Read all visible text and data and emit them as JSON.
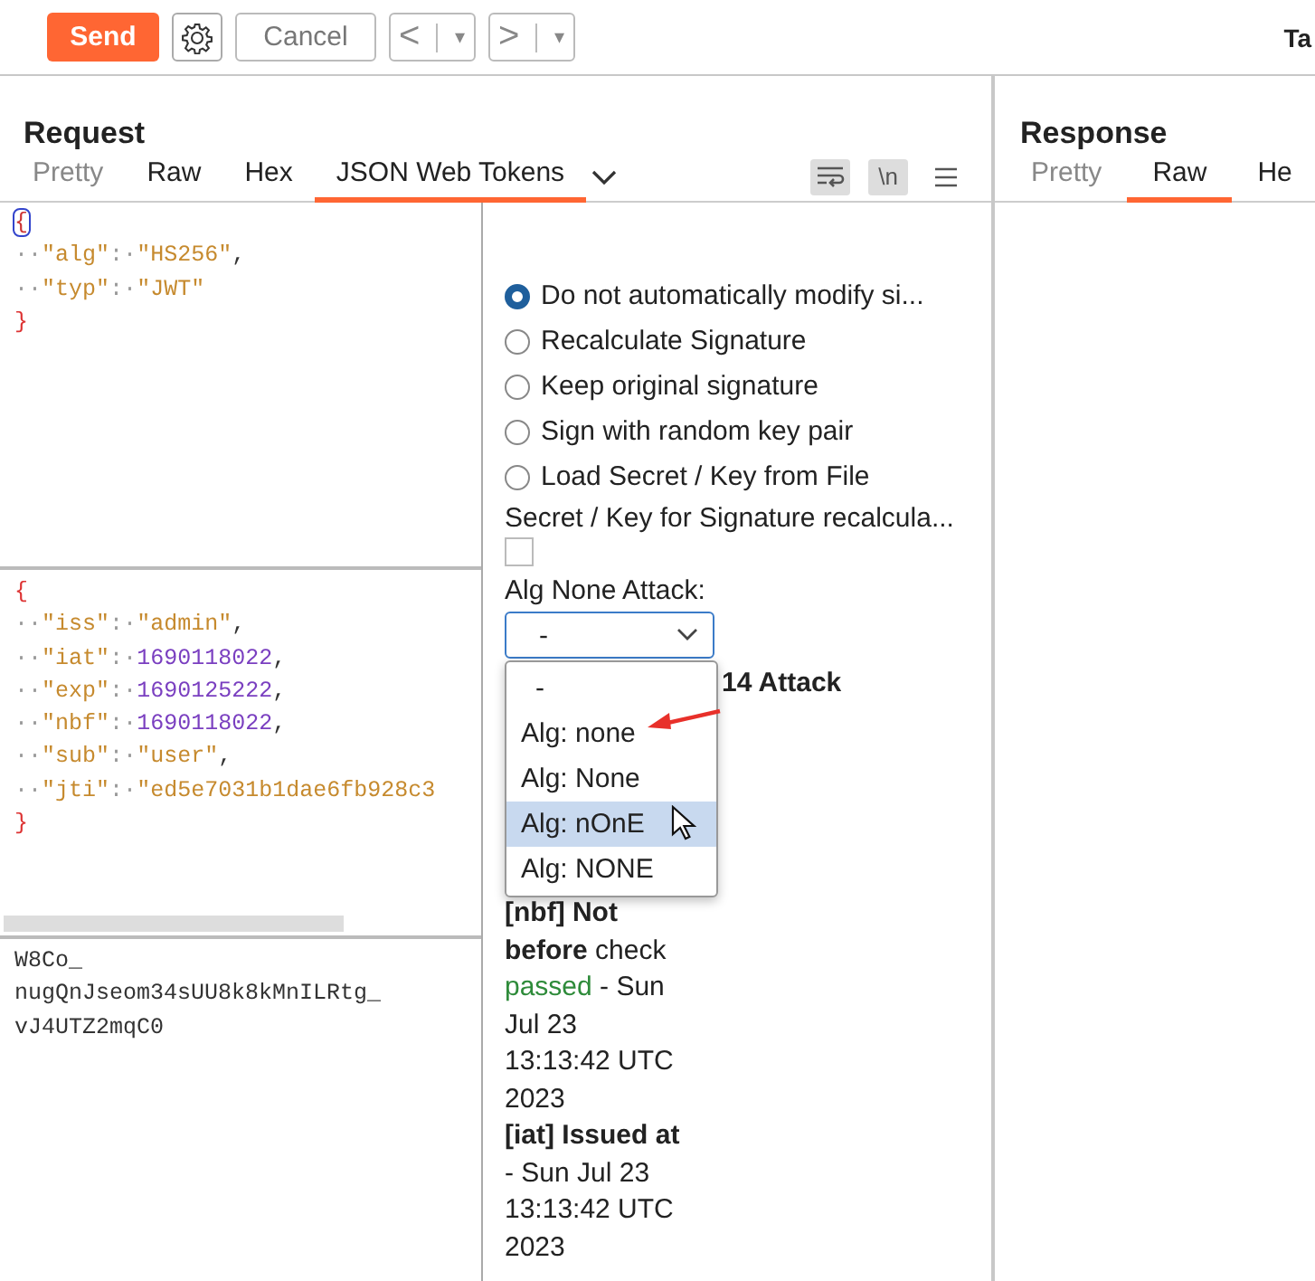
{
  "toolbar": {
    "send": "Send",
    "cancel": "Cancel",
    "back_arrow": "<",
    "back_caret": "▾",
    "forward_arrow": ">",
    "forward_caret": "▾",
    "cut_tab": "Ta"
  },
  "request": {
    "title": "Request",
    "tabs": [
      {
        "label": "Pretty",
        "selected": false,
        "muted": true
      },
      {
        "label": "Raw",
        "selected": false,
        "muted": false
      },
      {
        "label": "Hex",
        "selected": false,
        "muted": false
      },
      {
        "label": "JSON Web Tokens",
        "selected": true,
        "muted": false
      }
    ],
    "newline_toggle": "\\n",
    "header_lines": [
      [
        {
          "t": "{",
          "kind": "match"
        }
      ],
      [
        {
          "t": "··",
          "kind": "ws"
        },
        {
          "t": "\"alg\"",
          "kind": "str"
        },
        {
          "t": ":",
          "kind": "ws"
        },
        {
          "t": "·",
          "kind": "ws"
        },
        {
          "t": "\"HS256\"",
          "kind": "str"
        },
        {
          "t": ",",
          "kind": "punct"
        }
      ],
      [
        {
          "t": "··",
          "kind": "ws"
        },
        {
          "t": "\"typ\"",
          "kind": "str"
        },
        {
          "t": ":",
          "kind": "ws"
        },
        {
          "t": "·",
          "kind": "ws"
        },
        {
          "t": "\"JWT\"",
          "kind": "str"
        }
      ],
      [
        {
          "t": "}",
          "kind": "brace"
        }
      ]
    ],
    "payload_lines": [
      [
        {
          "t": "{",
          "kind": "brace"
        }
      ],
      [
        {
          "t": "··",
          "kind": "ws"
        },
        {
          "t": "\"iss\"",
          "kind": "str"
        },
        {
          "t": ":",
          "kind": "ws"
        },
        {
          "t": "·",
          "kind": "ws"
        },
        {
          "t": "\"admin\"",
          "kind": "str"
        },
        {
          "t": ",",
          "kind": "punct"
        }
      ],
      [
        {
          "t": "··",
          "kind": "ws"
        },
        {
          "t": "\"iat\"",
          "kind": "str"
        },
        {
          "t": ":",
          "kind": "ws"
        },
        {
          "t": "·",
          "kind": "ws"
        },
        {
          "t": "1690118022",
          "kind": "num"
        },
        {
          "t": ",",
          "kind": "punct"
        }
      ],
      [
        {
          "t": "··",
          "kind": "ws"
        },
        {
          "t": "\"exp\"",
          "kind": "str"
        },
        {
          "t": ":",
          "kind": "ws"
        },
        {
          "t": "·",
          "kind": "ws"
        },
        {
          "t": "1690125222",
          "kind": "num"
        },
        {
          "t": ",",
          "kind": "punct"
        }
      ],
      [
        {
          "t": "··",
          "kind": "ws"
        },
        {
          "t": "\"nbf\"",
          "kind": "str"
        },
        {
          "t": ":",
          "kind": "ws"
        },
        {
          "t": "·",
          "kind": "ws"
        },
        {
          "t": "1690118022",
          "kind": "num"
        },
        {
          "t": ",",
          "kind": "punct"
        }
      ],
      [
        {
          "t": "··",
          "kind": "ws"
        },
        {
          "t": "\"sub\"",
          "kind": "str"
        },
        {
          "t": ":",
          "kind": "ws"
        },
        {
          "t": "·",
          "kind": "ws"
        },
        {
          "t": "\"user\"",
          "kind": "str"
        },
        {
          "t": ",",
          "kind": "punct"
        }
      ],
      [
        {
          "t": "··",
          "kind": "ws"
        },
        {
          "t": "\"jti\"",
          "kind": "str"
        },
        {
          "t": ":",
          "kind": "ws"
        },
        {
          "t": "·",
          "kind": "ws"
        },
        {
          "t": "\"ed5e7031b1dae6fb928c3",
          "kind": "str"
        }
      ],
      [
        {
          "t": "}",
          "kind": "brace"
        }
      ]
    ],
    "signature_lines": [
      "W8Co_",
      "nugQnJseom34sUU8k8kMnILRtg_",
      "vJ4UTZ2mqC0"
    ]
  },
  "options": {
    "radios": [
      {
        "label": "Do not automatically modify si...",
        "selected": true
      },
      {
        "label": "Recalculate Signature",
        "selected": false
      },
      {
        "label": "Keep original signature",
        "selected": false
      },
      {
        "label": "Sign with random key pair",
        "selected": false
      },
      {
        "label": "Load Secret / Key from File",
        "selected": false
      }
    ],
    "secret_label": "Secret / Key for Signature recalcula...",
    "secret_checked": false,
    "alg_label": "Alg None Attack:",
    "alg_value": "-",
    "dropdown": [
      {
        "label": "-",
        "highlighted": false
      },
      {
        "label": "Alg: none",
        "highlighted": false
      },
      {
        "label": "Alg: None",
        "highlighted": false
      },
      {
        "label": "Alg: nOnE",
        "highlighted": true
      },
      {
        "label": "Alg: NONE",
        "highlighted": false
      }
    ],
    "behind_label": "14 Attack",
    "checks": [
      [
        {
          "t": "[nbf] Not before",
          "kind": "bold"
        },
        {
          "t": " check ",
          "kind": "plain"
        },
        {
          "t": "passed",
          "kind": "passed"
        },
        {
          "t": " - Sun Jul 23 13:13:42 UTC 2023",
          "kind": "plain"
        }
      ],
      [
        {
          "t": "[iat] Issued at",
          "kind": "bold"
        },
        {
          "t": " - Sun Jul 23 13:13:42 UTC 2023",
          "kind": "plain"
        }
      ]
    ]
  },
  "response": {
    "title": "Response",
    "tabs": [
      {
        "label": "Pretty",
        "selected": false,
        "muted": true
      },
      {
        "label": "Raw",
        "selected": true,
        "muted": false
      },
      {
        "label": "He",
        "selected": false,
        "muted": false
      }
    ]
  }
}
